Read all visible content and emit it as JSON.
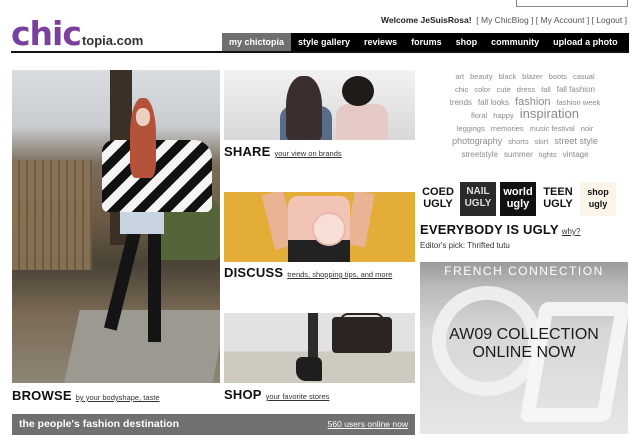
{
  "logo": {
    "main": "chic",
    "suffix": "topia.com"
  },
  "user_bar": {
    "greeting": "Welcome JeSuisRosa!",
    "links": [
      "My ChicBlog",
      "My Account",
      "Logout"
    ]
  },
  "nav": {
    "items": [
      "my chictopia",
      "style gallery",
      "reviews",
      "forums",
      "shop",
      "community",
      "upload a photo"
    ],
    "active": "my chictopia"
  },
  "sections": {
    "browse": {
      "title": "BROWSE",
      "subtitle": "by your bodyshape, taste"
    },
    "share": {
      "title": "SHARE",
      "subtitle": "your view on brands"
    },
    "discuss": {
      "title": "DISCUSS",
      "subtitle": "trends, shopping tips, and more"
    },
    "shop": {
      "title": "SHOP",
      "subtitle": "your favorite stores"
    }
  },
  "footer": {
    "tagline": "the people's fashion destination",
    "users_online": "560 users online now"
  },
  "tag_cloud": [
    "art",
    "beauty",
    "black",
    "blazer",
    "boots",
    "casual",
    "chic",
    "color",
    "cute",
    "dress",
    "fall",
    "fall fashion",
    "trends",
    "fall looks",
    "fashion",
    "fashion week",
    "floral",
    "happy",
    "inspiration",
    "leggings",
    "memories",
    "music festival",
    "noir",
    "photography",
    "shorts",
    "skirt",
    "street style",
    "streetstyle",
    "summer",
    "tights",
    "vintage"
  ],
  "ugly_brands": {
    "coed": "COED UGLY",
    "nail": "NAIL UGLY",
    "world": "world ugly",
    "teen": "TEEN UGLY",
    "shop": "shop ugly"
  },
  "ugly_section": {
    "title": "EVERYBODY IS UGLY",
    "why": "why?",
    "editors_pick": "Editor's pick: Thrifted tutu"
  },
  "ad": {
    "brand": "FRENCH CONNECTION",
    "line1": "AW09 COLLECTION",
    "line2": "ONLINE NOW"
  },
  "colors": {
    "brand_purple": "#7b3fa0",
    "nav_bg": "#000000",
    "nav_active": "#6f6f6f",
    "footer_bar": "#707070"
  }
}
